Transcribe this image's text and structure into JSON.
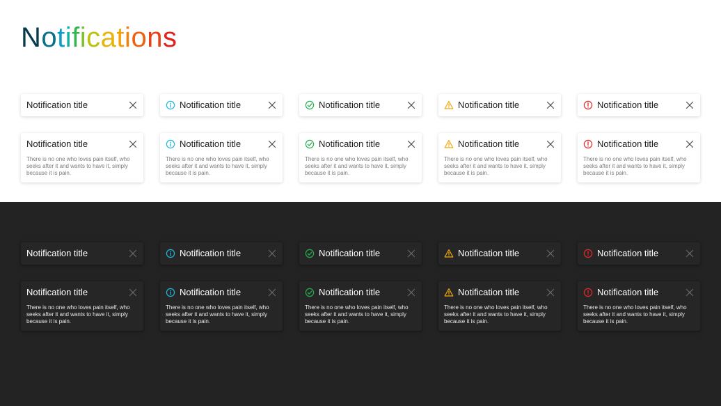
{
  "page": {
    "title_letters": [
      "N",
      "o",
      "t",
      "i",
      "f",
      "i",
      "c",
      "a",
      "t",
      "i",
      "o",
      "n",
      "s"
    ],
    "title_colors": [
      "#083a4b",
      "#0b6f86",
      "#0aa0c4",
      "#16b1a4",
      "#33b54e",
      "#7bc12a",
      "#bbc10f",
      "#e6b40a",
      "#f2a20b",
      "#f0850d",
      "#ec6211",
      "#e84016",
      "#e0201d"
    ]
  },
  "colors": {
    "info": "#1fb6d9",
    "success": "#22b04b",
    "warning": "#f0a70a",
    "error": "#e3282a",
    "close_light": "#4a4a4a",
    "close_dark": "#6a6a6a"
  },
  "notification": {
    "title": "Notification title",
    "body": "There is no one who loves pain itself, who seeks after it and wants to have it, simply because it is pain."
  },
  "variants": [
    {
      "type": "default",
      "icon": ""
    },
    {
      "type": "info",
      "icon": "info-icon"
    },
    {
      "type": "success",
      "icon": "check-circle-icon"
    },
    {
      "type": "warning",
      "icon": "warning-triangle-icon"
    },
    {
      "type": "error",
      "icon": "error-circle-icon"
    }
  ],
  "close_icon": "close-icon"
}
